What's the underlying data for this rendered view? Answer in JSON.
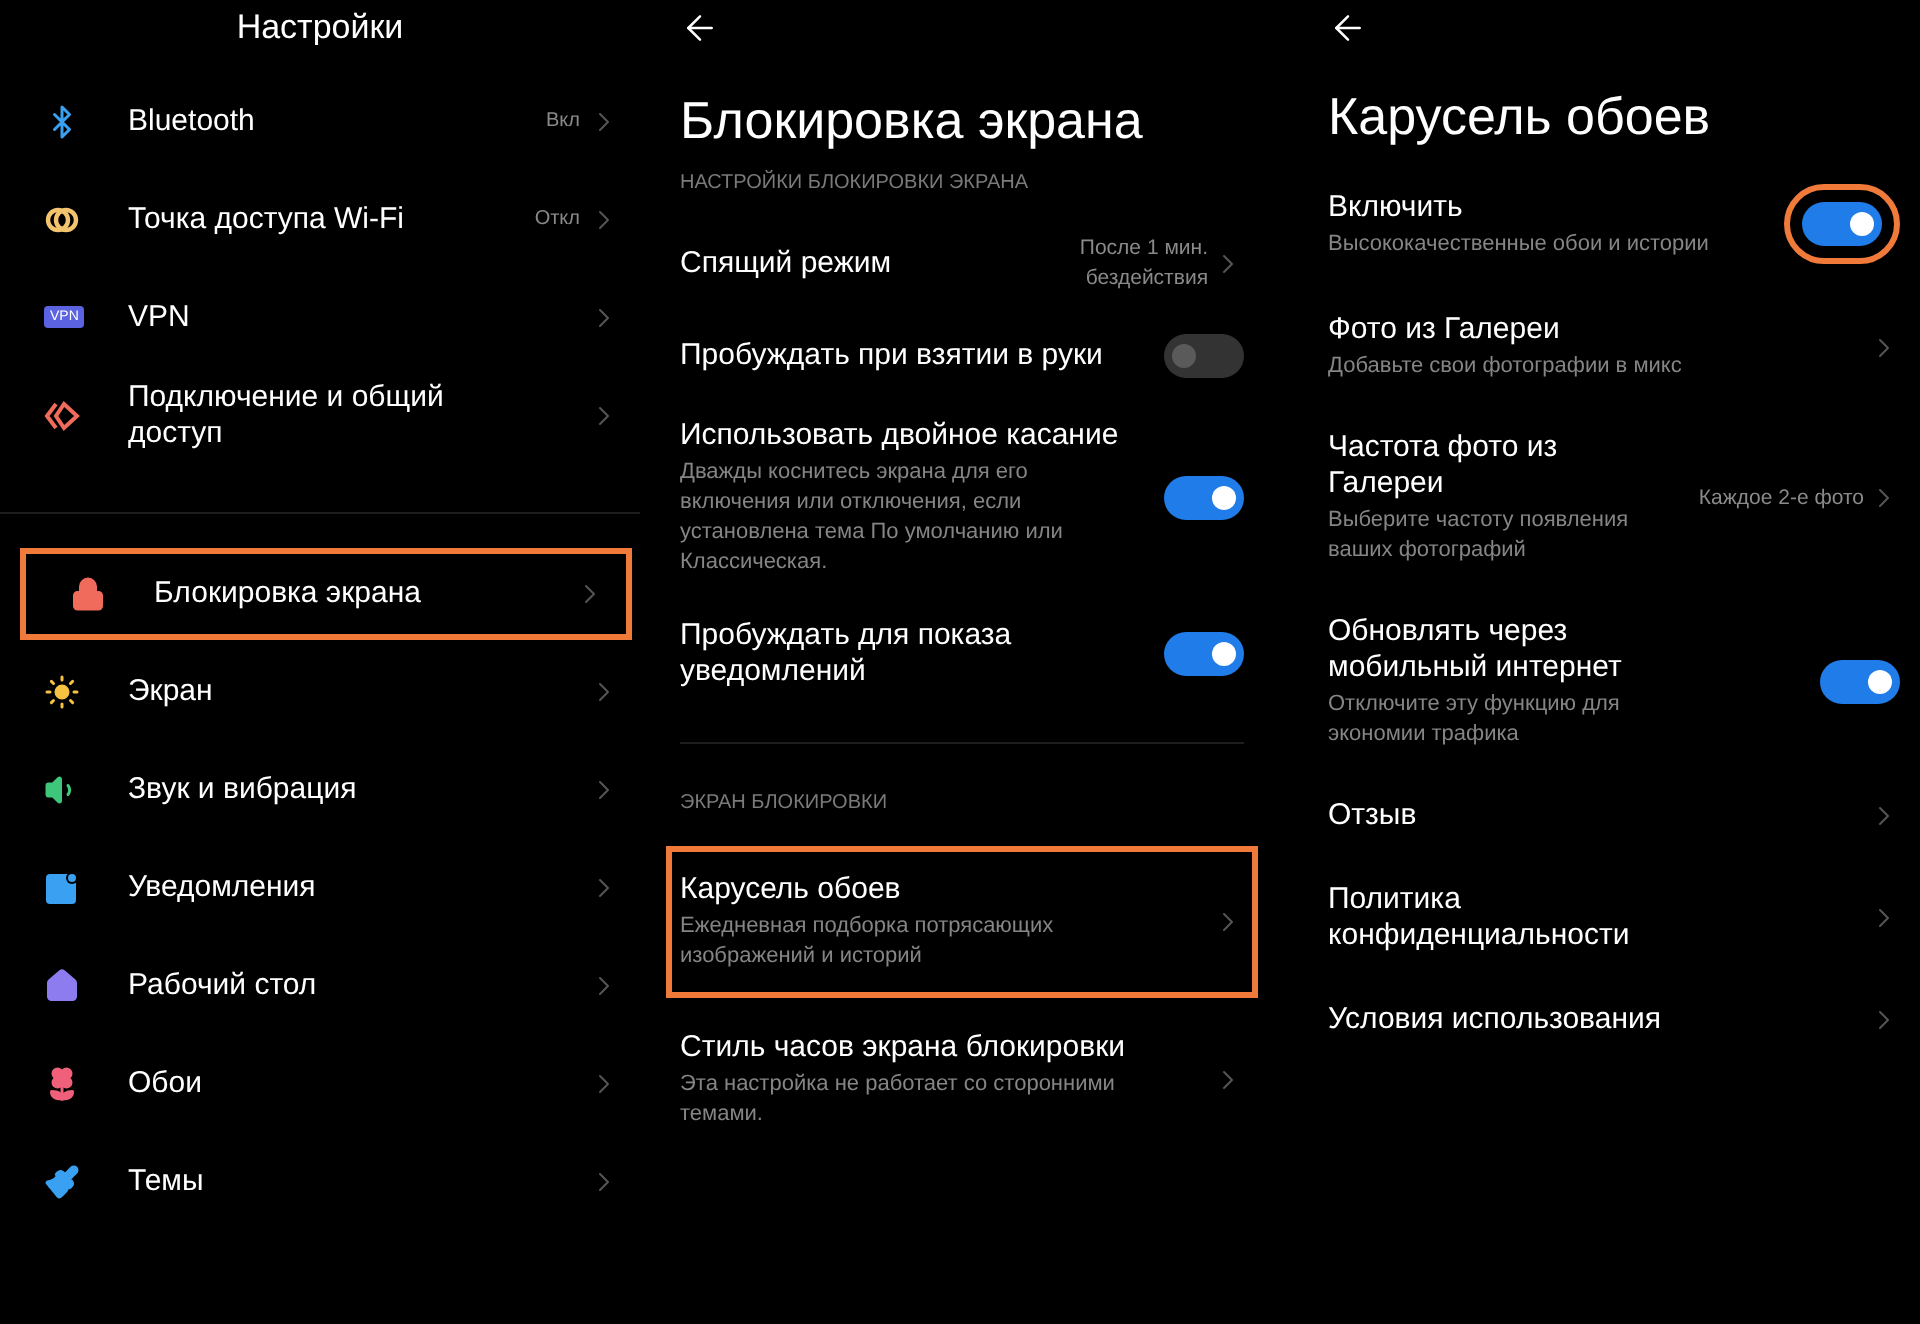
{
  "settings": {
    "title": "Настройки",
    "groups": [
      {
        "items": [
          {
            "label": "Bluetooth",
            "value": "Вкл",
            "highlighted": false
          },
          {
            "label": "Точка доступа Wi-Fi",
            "value": "Откл",
            "highlighted": false
          },
          {
            "label": "VPN",
            "badge": "VPN",
            "highlighted": false
          },
          {
            "label": "Подключение и общий доступ",
            "highlighted": false
          }
        ]
      },
      {
        "items": [
          {
            "label": "Блокировка экрана",
            "highlighted": true
          },
          {
            "label": "Экран",
            "highlighted": false
          },
          {
            "label": "Звук и вибрация",
            "highlighted": false
          },
          {
            "label": "Уведомления",
            "highlighted": false
          },
          {
            "label": "Рабочий стол",
            "highlighted": false
          },
          {
            "label": "Обои",
            "highlighted": false
          },
          {
            "label": "Темы",
            "highlighted": false
          }
        ]
      }
    ]
  },
  "lock_screen": {
    "title": "Блокировка экрана",
    "sections": [
      {
        "header": "НАСТРОЙКИ БЛОКИРОВКИ ЭКРАНА",
        "items": [
          {
            "kind": "link",
            "label": "Спящий режим",
            "value": "После 1 мин. бездействия",
            "highlighted": false
          },
          {
            "kind": "toggle",
            "label": "Пробуждать при взятии в руки",
            "on": false,
            "highlighted": false
          },
          {
            "kind": "toggle",
            "label": "Использовать двойное касание",
            "subtitle": "Дважды коснитесь экрана для его включения или отключения, если установлена тема По умолчанию или Классическая.",
            "on": true,
            "highlighted": false
          },
          {
            "kind": "toggle",
            "label": "Пробуждать для показа уведомлений",
            "on": true,
            "highlighted": false
          }
        ]
      },
      {
        "header": "ЭКРАН БЛОКИРОВКИ",
        "items": [
          {
            "kind": "link",
            "label": "Карусель обоев",
            "subtitle": "Ежедневная подборка потрясающих изображений и историй",
            "highlighted": true
          },
          {
            "kind": "link",
            "label": "Стиль часов экрана блокировки",
            "subtitle": "Эта настройка не работает со сторонними темами.",
            "highlighted": false
          }
        ]
      }
    ]
  },
  "carousel": {
    "title": "Карусель обоев",
    "items": [
      {
        "kind": "toggle",
        "label": "Включить",
        "subtitle": "Высококачественные обои и истории",
        "on": true,
        "highlighted": true
      },
      {
        "kind": "link",
        "label": "Фото из Галереи",
        "subtitle": "Добавьте свои фотографии в микс",
        "highlighted": false
      },
      {
        "kind": "link",
        "label": "Частота фото из Галереи",
        "subtitle": "Выберите частоту появления ваших фотографий",
        "value": "Каждое 2-е фото",
        "highlighted": false
      },
      {
        "kind": "toggle",
        "label": "Обновлять через мобильный интернет",
        "subtitle": "Отключите эту функцию для экономии трафика",
        "on": true,
        "highlighted": false
      },
      {
        "kind": "link",
        "label": "Отзыв",
        "highlighted": false
      },
      {
        "kind": "link",
        "label": "Политика конфиденциальности",
        "highlighted": false
      },
      {
        "kind": "link",
        "label": "Условия использования",
        "highlighted": false
      }
    ]
  }
}
